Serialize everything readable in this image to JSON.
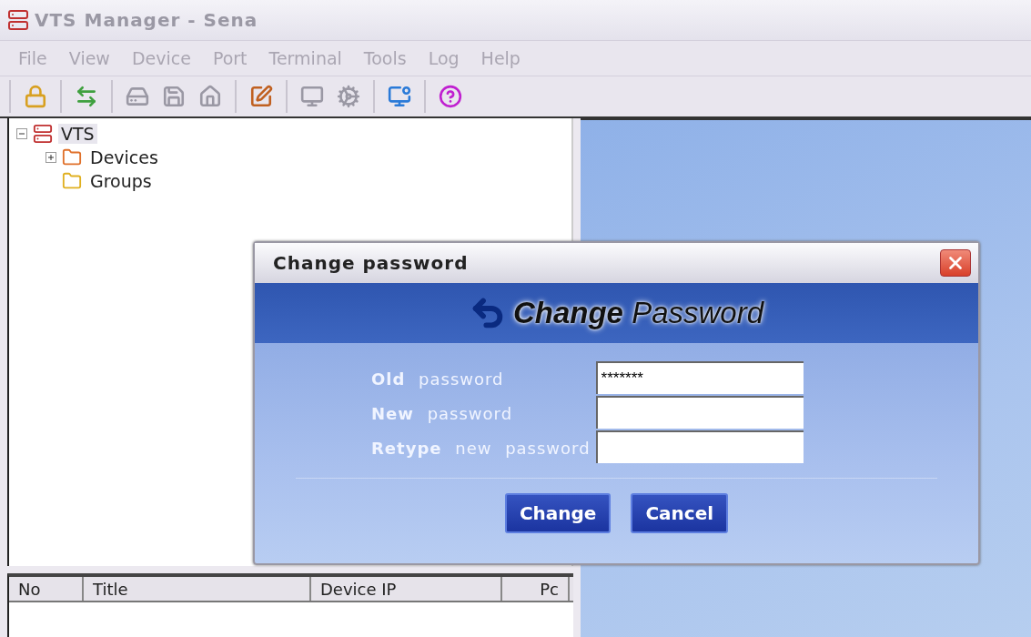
{
  "window": {
    "title": "VTS Manager - Sena"
  },
  "menu": [
    {
      "label": "File",
      "disabled": true
    },
    {
      "label": "View",
      "disabled": true
    },
    {
      "label": "Device",
      "disabled": true
    },
    {
      "label": "Port",
      "disabled": true
    },
    {
      "label": "Terminal",
      "disabled": true
    },
    {
      "label": "Tools",
      "disabled": true
    },
    {
      "label": "Log",
      "disabled": true
    },
    {
      "label": "Help",
      "disabled": true
    }
  ],
  "toolbar": [
    [
      {
        "disabled": false
      }
    ],
    [
      {
        "disabled": false
      }
    ],
    [
      {
        "disabled": true
      },
      {
        "disabled": true
      },
      {
        "disabled": true
      }
    ],
    [
      {
        "disabled": false
      }
    ],
    [
      {
        "disabled": true
      },
      {
        "disabled": true
      }
    ],
    [
      {
        "disabled": false
      }
    ],
    [
      {
        "disabled": false
      }
    ]
  ],
  "tree": [
    {
      "label": "VTS",
      "kind": "root",
      "selected": true,
      "expanded": true,
      "children": [
        {
          "label": "Devices",
          "kind": "devices",
          "selected": false,
          "expanded": false
        },
        {
          "label": "Groups",
          "kind": "groups",
          "selected": false
        }
      ]
    }
  ],
  "table": {
    "columns": [
      "No",
      "Title",
      "Device IP",
      "Pc"
    ]
  },
  "dialog": {
    "title": "Change password",
    "banner": "**Change** Password",
    "fields": [
      {
        "label": "**Old** password",
        "value": "*******"
      },
      {
        "label": "**New** password"
      },
      {
        "label": "**Retype** new password"
      }
    ],
    "buttons": [
      "Change",
      "Cancel"
    ]
  }
}
